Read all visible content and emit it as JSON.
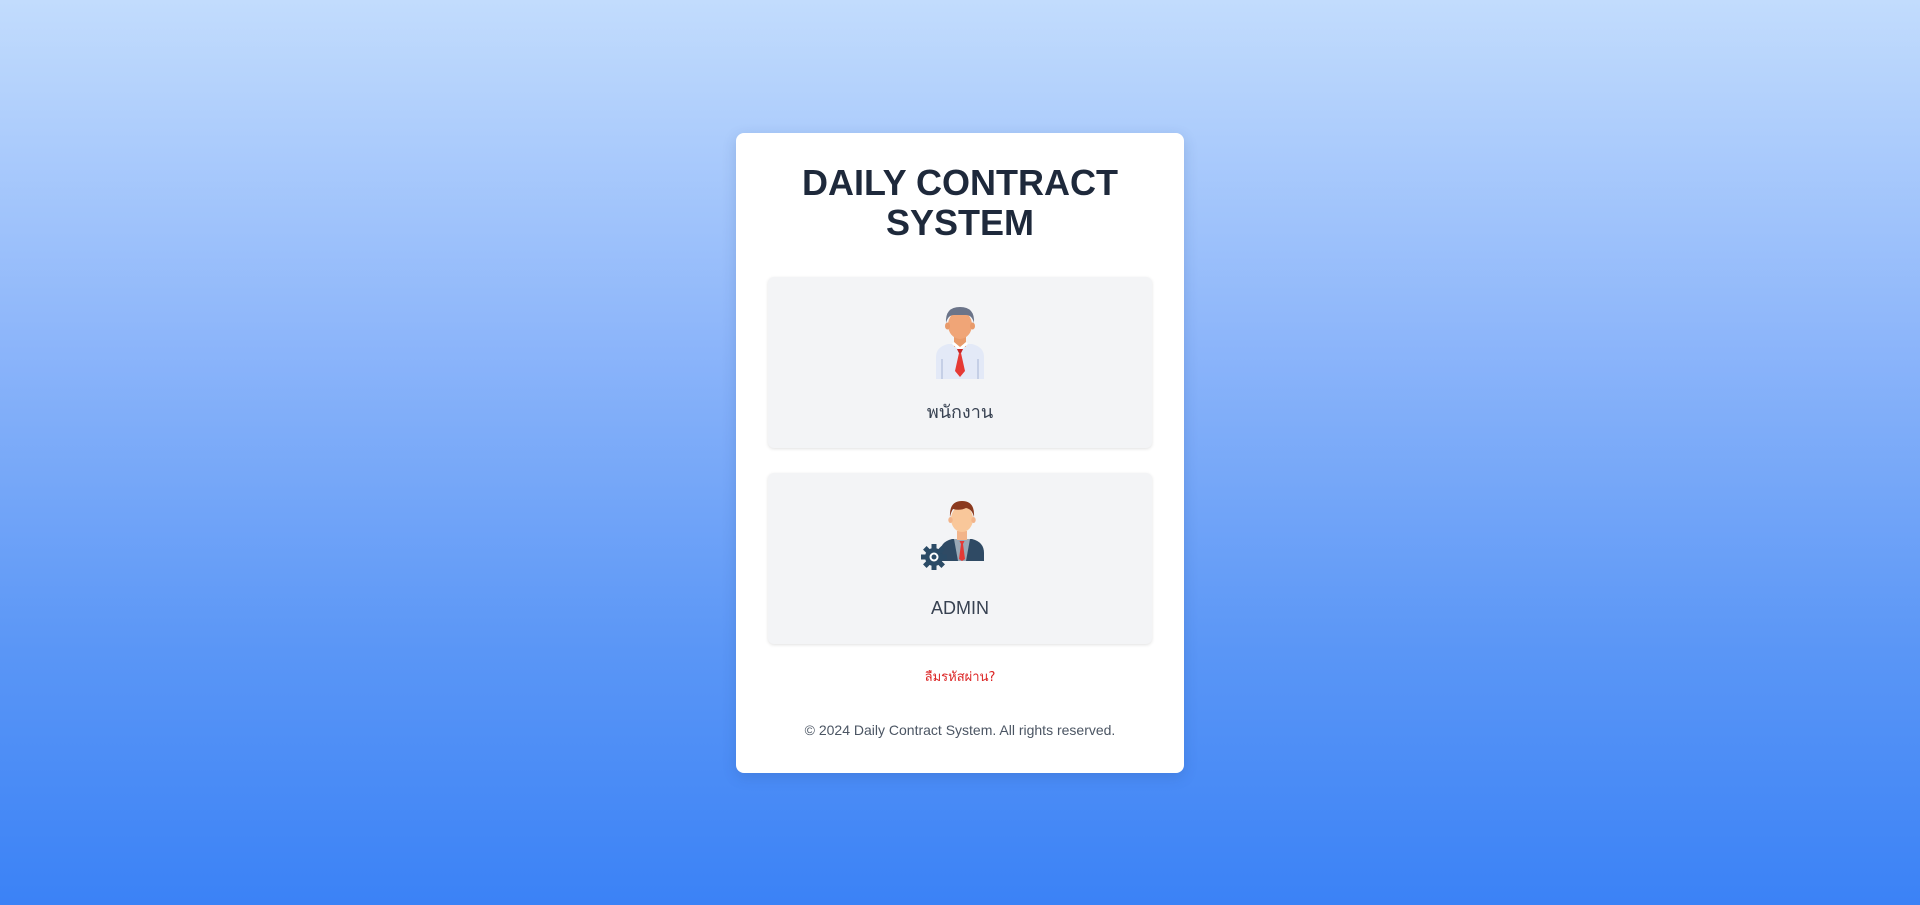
{
  "app": {
    "title": "DAILY CONTRACT SYSTEM"
  },
  "roles": [
    {
      "label": "พนักงาน",
      "icon": "employee-icon"
    },
    {
      "label": "ADMIN",
      "icon": "admin-icon"
    }
  ],
  "links": {
    "forgot_password": "ลืมรหัสผ่าน?"
  },
  "footer": {
    "copyright": "© 2024 Daily Contract System. All rights reserved."
  },
  "colors": {
    "accent": "#3b82f6",
    "title": "#1e293b",
    "link": "#dc2626",
    "tie": "#e53935",
    "button_bg": "#f3f4f6"
  }
}
